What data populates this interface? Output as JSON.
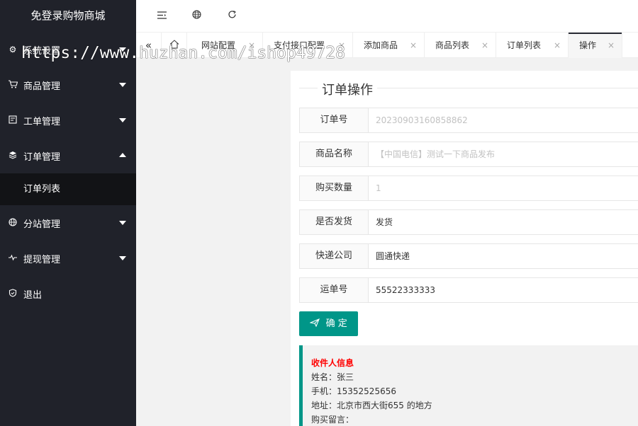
{
  "app_title": "免登录购物商城",
  "sidebar": {
    "items": [
      {
        "label": "系统设置",
        "icon": "gear-icon"
      },
      {
        "label": "商品管理",
        "icon": "cart-icon"
      },
      {
        "label": "工单管理",
        "icon": "ticket-icon"
      },
      {
        "label": "订单管理",
        "icon": "layers-icon",
        "sub": [
          {
            "label": "订单列表"
          }
        ]
      },
      {
        "label": "分站管理",
        "icon": "globe-icon"
      },
      {
        "label": "提现管理",
        "icon": "pulse-icon"
      },
      {
        "label": "退出",
        "icon": "shield-icon"
      }
    ]
  },
  "tabs": [
    {
      "label": "网站配置"
    },
    {
      "label": "支付接口配置"
    },
    {
      "label": "添加商品"
    },
    {
      "label": "商品列表"
    },
    {
      "label": "订单列表"
    },
    {
      "label": "操作"
    }
  ],
  "form": {
    "legend": "订单操作",
    "order_no": {
      "label": "订单号",
      "value": "20230903160858862"
    },
    "product_name": {
      "label": "商品名称",
      "value": "【中国电信】测试一下商品发布"
    },
    "quantity": {
      "label": "购买数量",
      "value": "1"
    },
    "shipped": {
      "label": "是否发货",
      "value": "发货"
    },
    "courier": {
      "label": "快递公司",
      "value": "圆通快递"
    },
    "tracking_no": {
      "label": "运单号",
      "value": "55522333333"
    },
    "confirm_label": "确 定"
  },
  "recipient": {
    "title": "收件人信息",
    "name": "姓名：张三",
    "phone": "手机：15352525656",
    "address": "地址：北京市西大街655 的地方",
    "note": "购买留言："
  },
  "watermark": "https://www.huzhan.com/ishop49728"
}
